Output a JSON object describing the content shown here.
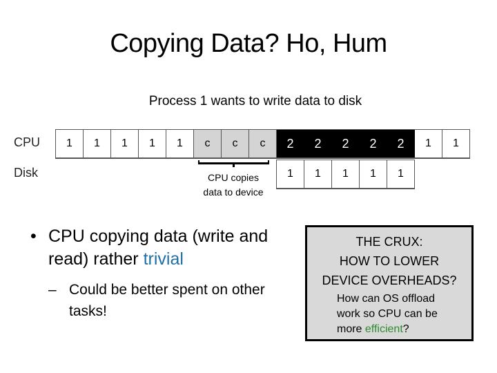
{
  "slide": {
    "title": "Copying Data? Ho, Hum",
    "subtitle": "Process 1 wants to write data to disk"
  },
  "timeline": {
    "rows": [
      {
        "label": "CPU",
        "cells": [
          {
            "text": "1",
            "kind": "process1"
          },
          {
            "text": "1",
            "kind": "process1"
          },
          {
            "text": "1",
            "kind": "process1"
          },
          {
            "text": "1",
            "kind": "process1"
          },
          {
            "text": "1",
            "kind": "process1"
          },
          {
            "text": "c",
            "kind": "copy"
          },
          {
            "text": "c",
            "kind": "copy"
          },
          {
            "text": "c",
            "kind": "copy"
          },
          {
            "text": "2",
            "kind": "process2"
          },
          {
            "text": "2",
            "kind": "process2"
          },
          {
            "text": "2",
            "kind": "process2"
          },
          {
            "text": "2",
            "kind": "process2"
          },
          {
            "text": "2",
            "kind": "process2"
          },
          {
            "text": "1",
            "kind": "process1"
          },
          {
            "text": "1",
            "kind": "process1"
          }
        ]
      },
      {
        "label": "Disk",
        "cells": [
          {
            "text": "1",
            "kind": "process1"
          },
          {
            "text": "1",
            "kind": "process1"
          },
          {
            "text": "1",
            "kind": "process1"
          },
          {
            "text": "1",
            "kind": "process1"
          },
          {
            "text": "1",
            "kind": "process1"
          }
        ]
      }
    ],
    "annotation": {
      "line1": "CPU copies",
      "line2": "data to device"
    },
    "colors": {
      "process1": "#ffffff",
      "copy": "#d4d4d4",
      "process2": "#000000"
    }
  },
  "bullets": {
    "main": {
      "text_before": "CPU copying data (write and read) rather ",
      "highlight": "trivial",
      "highlight_color": "#1f6fa8"
    },
    "sub": {
      "text": "Could be better spent on other tasks!"
    }
  },
  "crux": {
    "heading_line1": "THE CRUX:",
    "heading_line2": "HOW TO LOWER",
    "heading_line3": "DEVICE OVERHEADS?",
    "body_line1": "How can OS offload",
    "body_line2": "work so CPU can be",
    "body_line3_before": "more ",
    "body_highlight": "efficient",
    "body_line3_after": "?",
    "highlight_color": "#2e8b2e",
    "background": "#d9d9d9"
  }
}
